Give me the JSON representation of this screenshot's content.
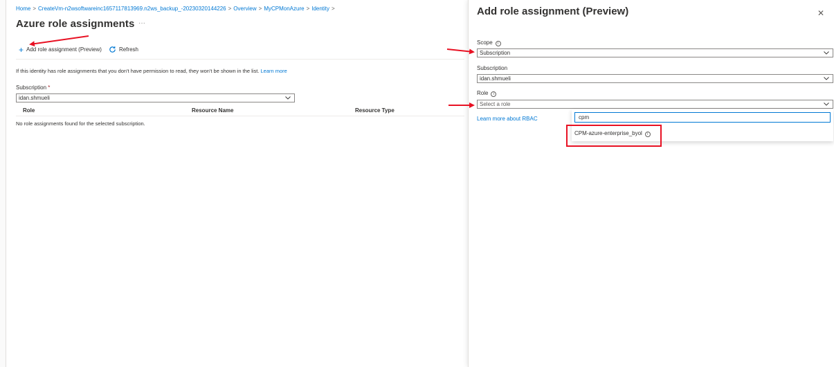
{
  "breadcrumb": {
    "items": [
      "Home",
      "CreateVm-n2wsoftwareinc1657117813969.n2ws_backup_-20230320144226",
      "Overview",
      "MyCPMonAzure",
      "Identity"
    ],
    "separator": ">"
  },
  "left": {
    "title": "Azure role assignments",
    "more": "···",
    "toolbar": {
      "add_label": "Add role assignment (Preview)",
      "refresh_label": "Refresh"
    },
    "info_text": "If this identity has role assignments that you don't have permission to read, they won't be shown in the list.",
    "learn_more": "Learn more",
    "subscription_label": "Subscription",
    "required_mark": "*",
    "subscription_value": "idan.shmueli",
    "columns": [
      "Role",
      "Resource Name",
      "Resource Type"
    ],
    "empty_message": "No role assignments found for the selected subscription."
  },
  "panel": {
    "title": "Add role assignment (Preview)",
    "close": "✕",
    "scope_label": "Scope",
    "scope_value": "Subscription",
    "subscription_label": "Subscription",
    "subscription_value": "idan.shmueli",
    "role_label": "Role",
    "role_placeholder": "Select a role",
    "learn_more_rbac": "Learn more about RBAC",
    "search_value": "cpm",
    "options": [
      "CPM-azure-enterprise_byol"
    ]
  },
  "colors": {
    "accent": "#0078d4",
    "annotation": "#e81123"
  },
  "icons": [
    "plus-icon",
    "refresh-icon",
    "info-icon",
    "chevron-down-icon",
    "close-icon",
    "more-icon"
  ]
}
